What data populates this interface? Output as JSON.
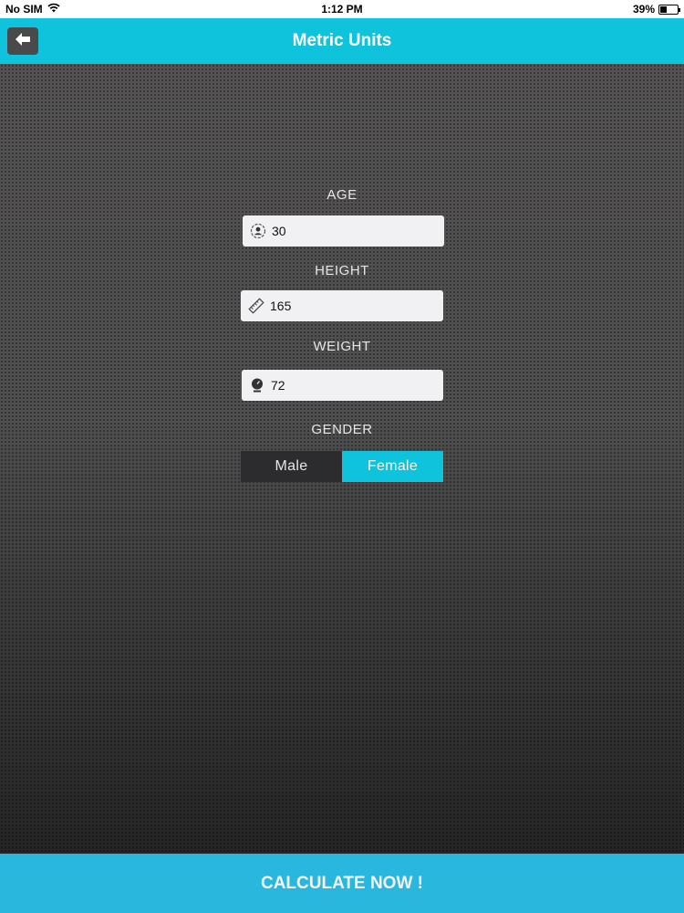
{
  "status_bar": {
    "carrier": "No SIM",
    "time": "1:12 PM",
    "battery": "39%",
    "battery_level": 0.39
  },
  "nav": {
    "title": "Metric Units",
    "back_icon": "arrow-left-icon"
  },
  "form": {
    "age": {
      "label": "AGE",
      "value": "30",
      "icon": "person-icon"
    },
    "height": {
      "label": "HEIGHT",
      "value": "165",
      "icon": "ruler-icon"
    },
    "weight": {
      "label": "WEIGHT",
      "value": "72",
      "icon": "scale-icon"
    },
    "gender": {
      "label": "GENDER",
      "options": [
        "Male",
        "Female"
      ],
      "selected": "Female"
    }
  },
  "calculate_label": "CALCULATE NOW !",
  "colors": {
    "accent": "#10c3dc",
    "button": "#29b7dd",
    "field_bg": "#f1f0f3",
    "dark": "#2c2b2e"
  }
}
